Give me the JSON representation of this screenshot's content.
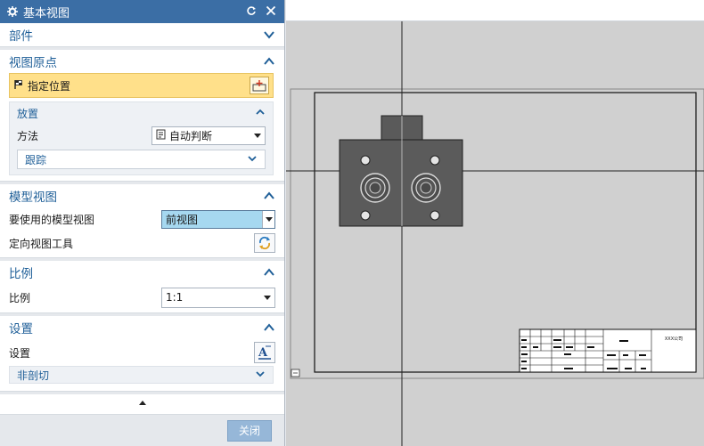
{
  "dialog": {
    "title": "基本视图",
    "sections": {
      "part": {
        "label": "部件"
      },
      "view_origin": {
        "label": "视图原点",
        "specify_location": "指定位置",
        "placement": {
          "label": "放置",
          "method_label": "方法",
          "method_value": "自动判断",
          "tracking_label": "跟踪"
        }
      },
      "model_view": {
        "label": "模型视图",
        "model_view_to_use_label": "要使用的模型视图",
        "model_view_to_use_value": "前视图",
        "orient_view_tool_label": "定向视图工具"
      },
      "scale": {
        "label": "比例",
        "scale_label": "比例",
        "scale_value": "1:1"
      },
      "settings": {
        "label": "设置",
        "settings_label": "设置",
        "non_section_label": "非剖切"
      }
    },
    "close_label": "关闭"
  },
  "drawing": {
    "title_block": {
      "company_text": "XXX公司"
    }
  }
}
